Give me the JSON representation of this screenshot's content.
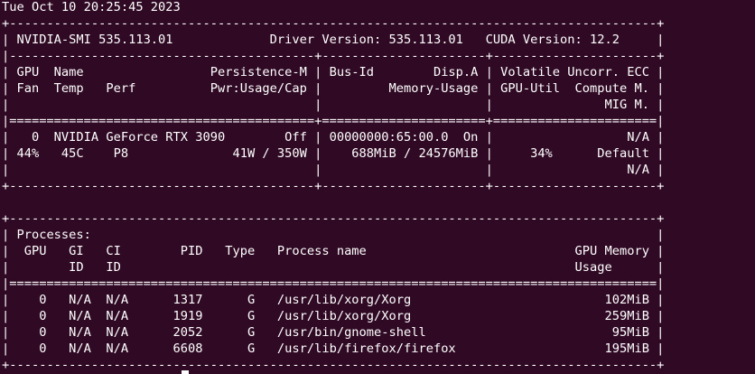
{
  "terminal": {
    "background_color": "#300a24",
    "text_color": "#ffffff",
    "lines": [
      "Tue Oct 10 20:25:45 2023",
      "+---------------------------------------------------------------------------------------+",
      "| NVIDIA-SMI 535.113.01             Driver Version: 535.113.01   CUDA Version: 12.2     |",
      "|-----------------------------------------+----------------------+----------------------+",
      "| GPU  Name                 Persistence-M | Bus-Id        Disp.A | Volatile Uncorr. ECC |",
      "| Fan  Temp   Perf          Pwr:Usage/Cap |         Memory-Usage | GPU-Util  Compute M. |",
      "|                                         |                      |               MIG M. |",
      "|=========================================+======================+======================|",
      "|   0  NVIDIA GeForce RTX 3090        Off | 00000000:65:00.0  On |                  N/A |",
      "| 44%   45C    P8              41W / 350W |    688MiB / 24576MiB |     34%      Default |",
      "|                                         |                      |                  N/A |",
      "+-----------------------------------------+----------------------+----------------------+",
      "",
      "+---------------------------------------------------------------------------------------+",
      "| Processes:                                                                            |",
      "|  GPU   GI   CI        PID   Type   Process name                            GPU Memory |",
      "|        ID   ID                                                             Usage      |",
      "|=======================================================================================|",
      "|    0   N/A  N/A      1317      G   /usr/lib/xorg/Xorg                          102MiB |",
      "|    0   N/A  N/A      1919      G   /usr/lib/xorg/Xorg                          259MiB |",
      "|    0   N/A  N/A      2052      G   /usr/bin/gnome-shell                         95MiB |",
      "|    0   N/A  N/A      6608      G   /usr/lib/firefox/firefox                    195MiB |",
      "+---------------------------------------------------------------------------------------+"
    ]
  }
}
